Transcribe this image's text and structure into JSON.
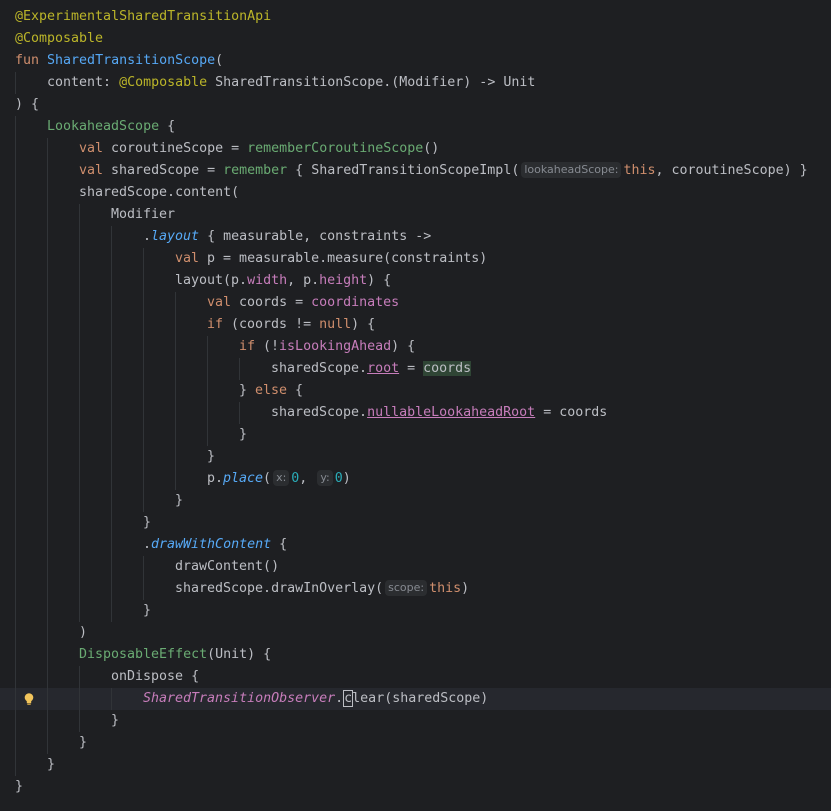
{
  "editor": {
    "lines": [
      {
        "indent": 0,
        "tokens": [
          {
            "t": "@ExperimentalSharedTransitionApi",
            "c": "t-ann"
          }
        ]
      },
      {
        "indent": 0,
        "tokens": [
          {
            "t": "@Composable",
            "c": "t-ann"
          }
        ]
      },
      {
        "indent": 0,
        "tokens": [
          {
            "t": "fun ",
            "c": "t-kw"
          },
          {
            "t": "SharedTransitionScope",
            "c": "t-fn"
          },
          {
            "t": "(",
            "c": ""
          }
        ]
      },
      {
        "indent": 1,
        "tokens": [
          {
            "t": "content: ",
            "c": ""
          },
          {
            "t": "@Composable",
            "c": "t-ann"
          },
          {
            "t": " SharedTransitionScope.(Modifier) -> Unit",
            "c": ""
          }
        ]
      },
      {
        "indent": 0,
        "tokens": [
          {
            "t": ") {",
            "c": ""
          }
        ]
      },
      {
        "indent": 1,
        "tokens": [
          {
            "t": "LookaheadScope",
            "c": "t-green"
          },
          {
            "t": " {",
            "c": ""
          }
        ]
      },
      {
        "indent": 2,
        "tokens": [
          {
            "t": "val",
            "c": "t-kw"
          },
          {
            "t": " coroutineScope = ",
            "c": ""
          },
          {
            "t": "rememberCoroutineScope",
            "c": "t-green"
          },
          {
            "t": "()",
            "c": ""
          }
        ]
      },
      {
        "indent": 2,
        "tokens": [
          {
            "t": "val",
            "c": "t-kw"
          },
          {
            "t": " sharedScope = ",
            "c": ""
          },
          {
            "t": "remember",
            "c": "t-green"
          },
          {
            "t": " { SharedTransitionScopeImpl(",
            "c": ""
          },
          {
            "t": "lookaheadScope:",
            "c": "hint"
          },
          {
            "t": "this",
            "c": "t-kw"
          },
          {
            "t": ", coroutineScope) }",
            "c": ""
          }
        ]
      },
      {
        "indent": 2,
        "tokens": [
          {
            "t": "sharedScope.content(",
            "c": ""
          }
        ]
      },
      {
        "indent": 3,
        "tokens": [
          {
            "t": "Modifier",
            "c": ""
          }
        ]
      },
      {
        "indent": 4,
        "tokens": [
          {
            "t": ".",
            "c": ""
          },
          {
            "t": "layout",
            "c": "t-ext"
          },
          {
            "t": " { measurable, constraints ->",
            "c": ""
          }
        ]
      },
      {
        "indent": 5,
        "tokens": [
          {
            "t": "val",
            "c": "t-kw"
          },
          {
            "t": " p = measurable.measure(constraints)",
            "c": ""
          }
        ]
      },
      {
        "indent": 5,
        "tokens": [
          {
            "t": "layout(p.",
            "c": ""
          },
          {
            "t": "width",
            "c": "t-purple"
          },
          {
            "t": ", p.",
            "c": ""
          },
          {
            "t": "height",
            "c": "t-purple"
          },
          {
            "t": ") {",
            "c": ""
          }
        ]
      },
      {
        "indent": 6,
        "tokens": [
          {
            "t": "val",
            "c": "t-kw"
          },
          {
            "t": " coords = ",
            "c": ""
          },
          {
            "t": "coordinates",
            "c": "t-purple"
          }
        ]
      },
      {
        "indent": 6,
        "tokens": [
          {
            "t": "if",
            "c": "t-kw"
          },
          {
            "t": " (coords != ",
            "c": ""
          },
          {
            "t": "null",
            "c": "t-kw"
          },
          {
            "t": ") {",
            "c": ""
          }
        ]
      },
      {
        "indent": 7,
        "tokens": [
          {
            "t": "if",
            "c": "t-kw"
          },
          {
            "t": " (!",
            "c": ""
          },
          {
            "t": "isLookingAhead",
            "c": "t-purple"
          },
          {
            "t": ") {",
            "c": ""
          }
        ]
      },
      {
        "indent": 8,
        "tokens": [
          {
            "t": "sharedScope.",
            "c": ""
          },
          {
            "t": "root",
            "c": "t-purple underline"
          },
          {
            "t": " = ",
            "c": ""
          },
          {
            "t": "coords",
            "c": "hl-match"
          }
        ]
      },
      {
        "indent": 7,
        "tokens": [
          {
            "t": "} ",
            "c": ""
          },
          {
            "t": "else",
            "c": "t-kw"
          },
          {
            "t": " {",
            "c": ""
          }
        ]
      },
      {
        "indent": 8,
        "tokens": [
          {
            "t": "sharedScope.",
            "c": ""
          },
          {
            "t": "nullableLookaheadRoot",
            "c": "t-purple underline"
          },
          {
            "t": " = coords",
            "c": ""
          }
        ]
      },
      {
        "indent": 7,
        "tokens": [
          {
            "t": "}",
            "c": ""
          }
        ]
      },
      {
        "indent": 6,
        "tokens": [
          {
            "t": "}",
            "c": ""
          }
        ]
      },
      {
        "indent": 6,
        "tokens": [
          {
            "t": "p.",
            "c": ""
          },
          {
            "t": "place",
            "c": "t-ext"
          },
          {
            "t": "(",
            "c": ""
          },
          {
            "t": "x:",
            "c": "hint"
          },
          {
            "t": "0",
            "c": "t-num"
          },
          {
            "t": ", ",
            "c": ""
          },
          {
            "t": "y:",
            "c": "hint"
          },
          {
            "t": "0",
            "c": "t-num"
          },
          {
            "t": ")",
            "c": ""
          }
        ]
      },
      {
        "indent": 5,
        "tokens": [
          {
            "t": "}",
            "c": ""
          }
        ]
      },
      {
        "indent": 4,
        "tokens": [
          {
            "t": "}",
            "c": ""
          }
        ]
      },
      {
        "indent": 4,
        "tokens": [
          {
            "t": ".",
            "c": ""
          },
          {
            "t": "drawWithContent",
            "c": "t-ext"
          },
          {
            "t": " {",
            "c": ""
          }
        ]
      },
      {
        "indent": 5,
        "tokens": [
          {
            "t": "drawContent()",
            "c": ""
          }
        ]
      },
      {
        "indent": 5,
        "tokens": [
          {
            "t": "sharedScope.drawInOverlay(",
            "c": ""
          },
          {
            "t": "scope:",
            "c": "hint"
          },
          {
            "t": "this",
            "c": "t-kw"
          },
          {
            "t": ")",
            "c": ""
          }
        ]
      },
      {
        "indent": 4,
        "tokens": [
          {
            "t": "}",
            "c": ""
          }
        ]
      },
      {
        "indent": 2,
        "tokens": [
          {
            "t": ")",
            "c": ""
          }
        ]
      },
      {
        "indent": 2,
        "tokens": [
          {
            "t": "DisposableEffect",
            "c": "t-green"
          },
          {
            "t": "(Unit) {",
            "c": ""
          }
        ]
      },
      {
        "indent": 3,
        "tokens": [
          {
            "t": "onDispose",
            "c": ""
          },
          {
            "t": " {",
            "c": ""
          }
        ]
      },
      {
        "indent": 4,
        "current": true,
        "bulb": true,
        "tokens": [
          {
            "t": "SharedTransitionObserver",
            "c": "t-obj"
          },
          {
            "t": ".",
            "c": ""
          },
          {
            "t": "c",
            "c": "caret-box"
          },
          {
            "t": "lear",
            "c": ""
          },
          {
            "t": "(sharedScope)",
            "c": ""
          }
        ]
      },
      {
        "indent": 3,
        "tokens": [
          {
            "t": "}",
            "c": ""
          }
        ]
      },
      {
        "indent": 2,
        "tokens": [
          {
            "t": "}",
            "c": ""
          }
        ]
      },
      {
        "indent": 1,
        "tokens": [
          {
            "t": "}",
            "c": ""
          }
        ]
      },
      {
        "indent": 0,
        "tokens": [
          {
            "t": "}",
            "c": ""
          }
        ]
      }
    ]
  },
  "icons": {
    "intention": "lightbulb-icon"
  }
}
